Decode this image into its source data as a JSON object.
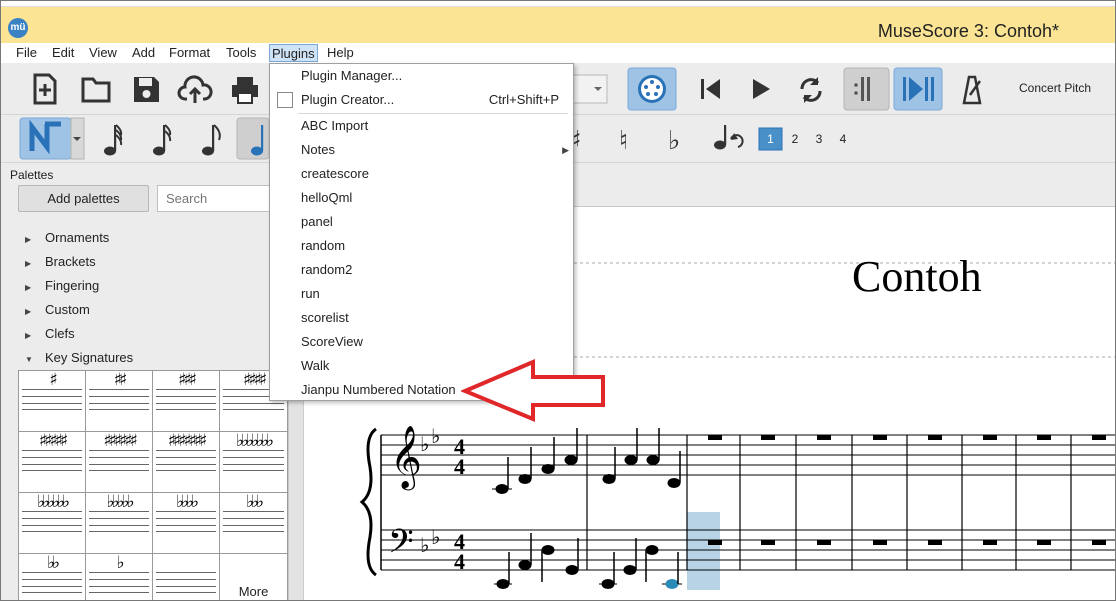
{
  "app": {
    "title": "MuseScore 3: Contoh*",
    "icon_text": "mü"
  },
  "menubar": {
    "items": [
      "File",
      "Edit",
      "View",
      "Add",
      "Format",
      "Tools",
      "Plugins",
      "Help"
    ],
    "active": "Plugins"
  },
  "toolbar": {
    "concert_pitch": "Concert Pitch",
    "voices": [
      "1",
      "2",
      "3",
      "4"
    ],
    "icons": [
      "new-file-icon",
      "open-folder-icon",
      "save-icon",
      "cloud-upload-icon",
      "print-icon",
      "midi-input-icon",
      "rewind-icon",
      "play-icon",
      "loop-icon",
      "metronome-icon"
    ]
  },
  "palettes": {
    "title": "Palettes",
    "add_button": "Add palettes",
    "search_placeholder": "Search",
    "items": [
      "Ornaments",
      "Brackets",
      "Fingering",
      "Custom",
      "Clefs",
      "Key Signatures"
    ],
    "keysig_more": "More"
  },
  "plugins_menu": {
    "items": [
      {
        "label": "Plugin Manager...",
        "shortcut": ""
      },
      {
        "label": "Plugin Creator...",
        "shortcut": "Ctrl+Shift+P"
      },
      {
        "label": "ABC Import",
        "shortcut": ""
      },
      {
        "label": "Notes",
        "shortcut": ""
      },
      {
        "label": "createscore",
        "shortcut": ""
      },
      {
        "label": "helloQml",
        "shortcut": ""
      },
      {
        "label": "panel",
        "shortcut": ""
      },
      {
        "label": "random",
        "shortcut": ""
      },
      {
        "label": "random2",
        "shortcut": ""
      },
      {
        "label": "run",
        "shortcut": ""
      },
      {
        "label": "scorelist",
        "shortcut": ""
      },
      {
        "label": "ScoreView",
        "shortcut": ""
      },
      {
        "label": "Walk",
        "shortcut": ""
      },
      {
        "label": "Jianpu Numbered Notation",
        "shortcut": ""
      }
    ]
  },
  "score": {
    "title": "Contoh",
    "time_signature": "4/4",
    "key": "2 flats"
  },
  "colors": {
    "titlebar": "#fbe594",
    "accent": "#2a72b8",
    "annotation_arrow": "#e0282a",
    "selection": "#b8d3e6"
  }
}
